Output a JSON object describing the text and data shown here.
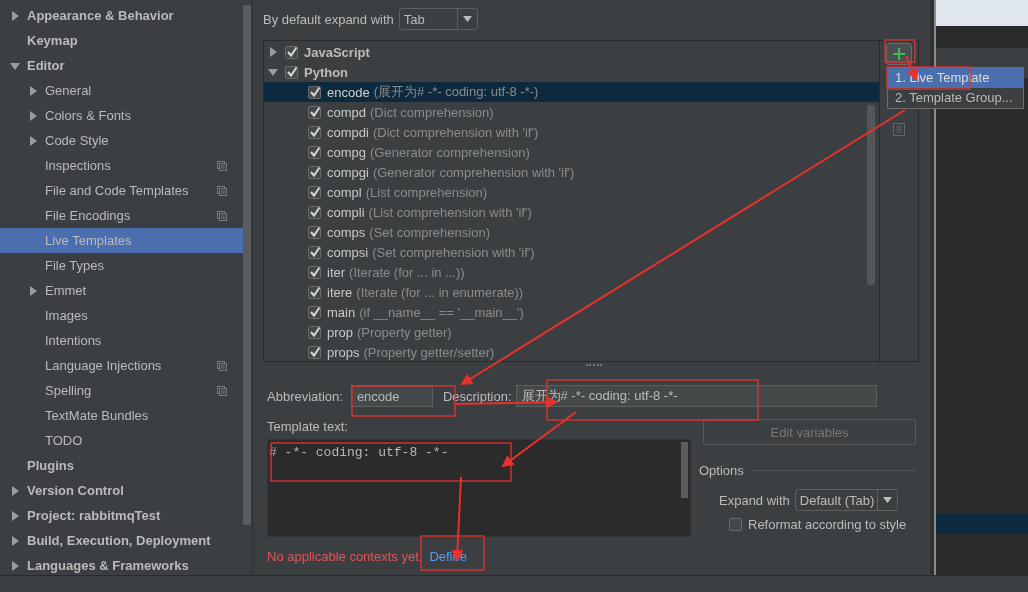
{
  "sidebar": {
    "items": [
      {
        "label": "Appearance & Behavior",
        "kind": "branch",
        "expanded": false,
        "selected": false,
        "project_level": false
      },
      {
        "label": "Keymap",
        "kind": "leaf",
        "selected": false,
        "project_level": false
      },
      {
        "label": "Editor",
        "kind": "branch",
        "expanded": true,
        "selected": false,
        "project_level": false,
        "children": [
          {
            "label": "General",
            "kind": "branch",
            "expanded": false,
            "selected": false,
            "project_level": false
          },
          {
            "label": "Colors & Fonts",
            "kind": "branch",
            "expanded": false,
            "selected": false,
            "project_level": false
          },
          {
            "label": "Code Style",
            "kind": "branch",
            "expanded": false,
            "selected": false,
            "project_level": false
          },
          {
            "label": "Inspections",
            "kind": "leaf",
            "selected": false,
            "project_level": true
          },
          {
            "label": "File and Code Templates",
            "kind": "leaf",
            "selected": false,
            "project_level": true
          },
          {
            "label": "File Encodings",
            "kind": "leaf",
            "selected": false,
            "project_level": true
          },
          {
            "label": "Live Templates",
            "kind": "leaf",
            "selected": true,
            "project_level": false
          },
          {
            "label": "File Types",
            "kind": "leaf",
            "selected": false,
            "project_level": false
          },
          {
            "label": "Emmet",
            "kind": "branch",
            "expanded": false,
            "selected": false,
            "project_level": false
          },
          {
            "label": "Images",
            "kind": "leaf",
            "selected": false,
            "project_level": false
          },
          {
            "label": "Intentions",
            "kind": "leaf",
            "selected": false,
            "project_level": false
          },
          {
            "label": "Language Injections",
            "kind": "leaf",
            "selected": false,
            "project_level": true
          },
          {
            "label": "Spelling",
            "kind": "leaf",
            "selected": false,
            "project_level": true
          },
          {
            "label": "TextMate Bundles",
            "kind": "leaf",
            "selected": false,
            "project_level": false
          },
          {
            "label": "TODO",
            "kind": "leaf",
            "selected": false,
            "project_level": false
          }
        ]
      },
      {
        "label": "Plugins",
        "kind": "leaf",
        "selected": false,
        "project_level": false
      },
      {
        "label": "Version Control",
        "kind": "branch",
        "expanded": false,
        "selected": false,
        "project_level": false
      },
      {
        "label": "Project: rabbitmqTest",
        "kind": "branch",
        "expanded": false,
        "selected": false,
        "project_level": false
      },
      {
        "label": "Build, Execution, Deployment",
        "kind": "branch",
        "expanded": false,
        "selected": false,
        "project_level": false
      },
      {
        "label": "Languages & Frameworks",
        "kind": "branch",
        "expanded": false,
        "selected": false,
        "project_level": false
      }
    ]
  },
  "expand_default": {
    "label": "By default expand with",
    "value": "Tab"
  },
  "template_groups": [
    {
      "name": "JavaScript",
      "expanded": false,
      "checked": true
    },
    {
      "name": "Python",
      "expanded": true,
      "checked": true,
      "templates": [
        {
          "abbreviation": "encode",
          "description": "(展开为# -*- coding: utf-8 -*-)",
          "checked": true,
          "selected": true
        },
        {
          "abbreviation": "compd",
          "description": "(Dict comprehension)",
          "checked": true,
          "selected": false
        },
        {
          "abbreviation": "compdi",
          "description": "(Dict comprehension with 'if')",
          "checked": true,
          "selected": false
        },
        {
          "abbreviation": "compg",
          "description": "(Generator comprehension)",
          "checked": true,
          "selected": false
        },
        {
          "abbreviation": "compgi",
          "description": "(Generator comprehension with 'if')",
          "checked": true,
          "selected": false
        },
        {
          "abbreviation": "compl",
          "description": "(List comprehension)",
          "checked": true,
          "selected": false
        },
        {
          "abbreviation": "compli",
          "description": "(List comprehension with 'if')",
          "checked": true,
          "selected": false
        },
        {
          "abbreviation": "comps",
          "description": "(Set comprehension)",
          "checked": true,
          "selected": false
        },
        {
          "abbreviation": "compsi",
          "description": "(Set comprehension with 'if')",
          "checked": true,
          "selected": false
        },
        {
          "abbreviation": "iter",
          "description": "(Iterate (for ... in ...))",
          "checked": true,
          "selected": false
        },
        {
          "abbreviation": "itere",
          "description": "(Iterate (for ... in enumerate))",
          "checked": true,
          "selected": false
        },
        {
          "abbreviation": "main",
          "description": "(if __name__ == '__main__')",
          "checked": true,
          "selected": false
        },
        {
          "abbreviation": "prop",
          "description": "(Property getter)",
          "checked": true,
          "selected": false
        },
        {
          "abbreviation": "props",
          "description": "(Property getter/setter)",
          "checked": true,
          "selected": false
        }
      ]
    }
  ],
  "add_menu": {
    "items": [
      {
        "label": "1. Live Template",
        "selected": true
      },
      {
        "label": "2. Template Group...",
        "selected": false
      }
    ]
  },
  "editor": {
    "abbreviation_label": "Abbreviation:",
    "abbreviation": "encode",
    "description_label": "Description:",
    "description": "展开为# -*- coding: utf-8 -*-",
    "template_label": "Template text:",
    "template_text": "# -*- coding: utf-8 -*-",
    "edit_variables": {
      "label": "Edit variables",
      "disabled": true
    },
    "options_label": "Options",
    "expand_with_label": "Expand with",
    "expand_with": "Default (Tab)",
    "reformat": {
      "label": "Reformat according to style",
      "checked": false
    },
    "contexts_message": "No applicable contexts yet.",
    "define_link": "Define"
  }
}
